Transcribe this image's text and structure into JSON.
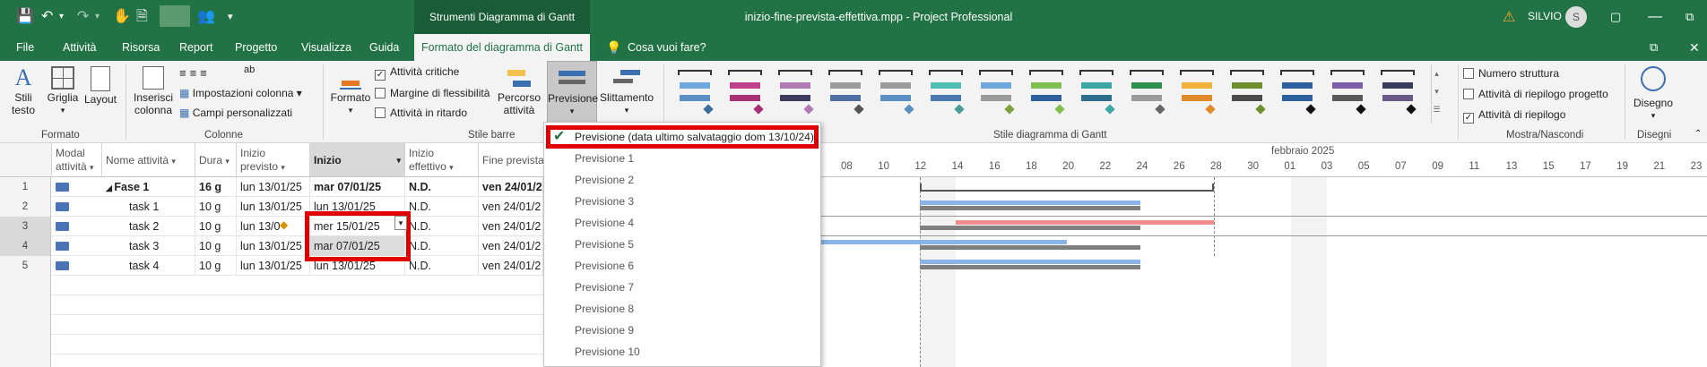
{
  "title_bar": {
    "context_tab": "Strumenti Diagramma di Gantt",
    "document_title": "inizio-fine-prevista-effettiva.mpp  -  Project Professional",
    "user_name": "SILVIO",
    "user_initial": "S"
  },
  "tabs": [
    "File",
    "Attività",
    "Risorsa",
    "Report",
    "Progetto",
    "Visualizza",
    "Guida",
    "Formato del diagramma di Gantt",
    "Cosa vuoi fare?"
  ],
  "ribbon": {
    "groups": {
      "formato": "Formato",
      "colonne": "Colonne",
      "stile_barre": "Stile barre",
      "stile_diagramma": "Stile diagramma di Gantt",
      "mostra_nascondi": "Mostra/Nascondi",
      "disegni": "Disegni"
    },
    "buttons": {
      "stili_testo": "Stili testo",
      "griglia": "Griglia",
      "layout": "Layout",
      "inserisci_colonna": "Inserisci colonna",
      "impostazioni_colonna": "Impostazioni colonna",
      "campi_personalizzati": "Campi personalizzati",
      "formato": "Formato",
      "percorso_attivita": "Percorso attività",
      "previsione": "Previsione",
      "slittamento": "Slittamento",
      "disegno": "Disegno"
    },
    "checkboxes": {
      "attivita_critiche": {
        "label": "Attività critiche",
        "checked": true
      },
      "margine_flessibilita": {
        "label": "Margine di flessibilità",
        "checked": false
      },
      "attivita_in_ritardo": {
        "label": "Attività in ritardo",
        "checked": false
      },
      "numero_struttura": {
        "label": "Numero struttura",
        "checked": false
      },
      "attivita_riepilogo_progetto": {
        "label": "Attività di riepilogo progetto",
        "checked": false
      },
      "attivita_riepilogo": {
        "label": "Attività di riepilogo",
        "checked": true
      }
    },
    "gantt_styles": [
      {
        "top": "#6fa8dc",
        "bottom": "#5a8fc4",
        "dia": "#3c6e9c"
      },
      {
        "top": "#c0408c",
        "bottom": "#a62f76",
        "dia": "#a62f76"
      },
      {
        "top": "#b07ab5",
        "bottom": "#3b3b5e",
        "dia": "#b07ab5"
      },
      {
        "top": "#9b9b9b",
        "bottom": "#4d6fa3",
        "dia": "#555555"
      },
      {
        "top": "#9b9b9b",
        "bottom": "#5a8fc4",
        "dia": "#5a8fc4"
      },
      {
        "top": "#4fbfb3",
        "bottom": "#4a78b0",
        "dia": "#4a9b9b"
      },
      {
        "top": "#6fa8dc",
        "bottom": "#9b9b9b",
        "dia": "#80a040"
      },
      {
        "top": "#7fbf4f",
        "bottom": "#2f5f9f",
        "dia": "#7fbf4f"
      },
      {
        "top": "#3fa6a6",
        "bottom": "#2e6f8f",
        "dia": "#3fa6a6"
      },
      {
        "top": "#2f8f4f",
        "bottom": "#9b9b9b",
        "dia": "#666666"
      },
      {
        "top": "#f2b13a",
        "bottom": "#e08a2a",
        "dia": "#e08a2a"
      },
      {
        "top": "#6f8f2f",
        "bottom": "#4a4a4a",
        "dia": "#6f8f2f"
      },
      {
        "top": "#2f5f9f",
        "bottom": "#2f5f9f",
        "dia": "#111111"
      },
      {
        "top": "#7a5fa8",
        "bottom": "#5a5a5a",
        "dia": "#111111"
      },
      {
        "top": "#3b3b5e",
        "bottom": "#6a5a8a",
        "dia": "#111111"
      }
    ]
  },
  "table": {
    "headers": [
      "Modal attività",
      "Nome attività",
      "Dura",
      "Inizio previsto",
      "Inizio",
      "Inizio effettivo",
      "Fine prevista"
    ],
    "rows": [
      {
        "num": "1",
        "name": "Fase 1",
        "dur": "16 g",
        "inizio_previsto": "lun 13/01/25",
        "inizio": "mar 07/01/25",
        "inizio_effettivo": "N.D.",
        "fine_prevista": "ven 24/01/2",
        "summary": true
      },
      {
        "num": "2",
        "name": "task 1",
        "dur": "10 g",
        "inizio_previsto": "lun 13/01/25",
        "inizio": "lun 13/01/25",
        "inizio_effettivo": "N.D.",
        "fine_prevista": "ven 24/01/2",
        "summary": false
      },
      {
        "num": "3",
        "name": "task 2",
        "dur": "10 g",
        "inizio_previsto": "lun 13/0",
        "inizio": "mer 15/01/25",
        "inizio_effettivo": "N.D.",
        "fine_prevista": "ven 24/01/2",
        "summary": false
      },
      {
        "num": "4",
        "name": "task 3",
        "dur": "10 g",
        "inizio_previsto": "lun 13/01/25",
        "inizio": "mar 07/01/25",
        "inizio_effettivo": "N.D.",
        "fine_prevista": "ven 24/01/2",
        "summary": false
      },
      {
        "num": "5",
        "name": "task 4",
        "dur": "10 g",
        "inizio_previsto": "lun 13/01/25",
        "inizio": "lun 13/01/25",
        "inizio_effettivo": "N.D.",
        "fine_prevista": "ven 24/01/2",
        "summary": false
      }
    ]
  },
  "timescale": {
    "month": "febbraio 2025",
    "days": [
      "08",
      "10",
      "12",
      "14",
      "16",
      "18",
      "20",
      "22",
      "24",
      "26",
      "28",
      "30",
      "01",
      "03",
      "05",
      "07",
      "09",
      "11",
      "13",
      "15",
      "17",
      "19",
      "21",
      "23"
    ]
  },
  "baseline_menu": {
    "selected": "Previsione (data ultimo salvataggio dom 13/10/24)",
    "items": [
      "Previsione 1",
      "Previsione 2",
      "Previsione 3",
      "Previsione 4",
      "Previsione 5",
      "Previsione 6",
      "Previsione 7",
      "Previsione 8",
      "Previsione 9",
      "Previsione 10"
    ]
  }
}
